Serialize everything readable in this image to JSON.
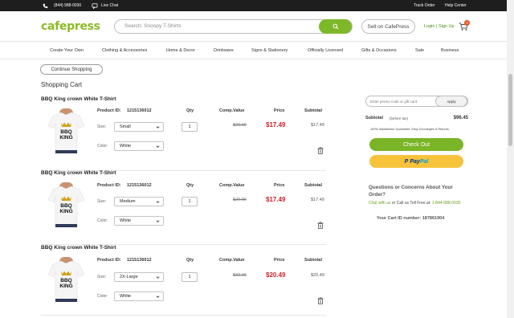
{
  "topbar": {
    "phone": "(844) 988-0030",
    "live_chat": "Live Chat",
    "track_order": "Track Order",
    "help_center": "Help Center"
  },
  "header": {
    "logo": "cafepress",
    "search_placeholder": "Search: Snoopy T-Shirts",
    "sell": "Sell on CafePress",
    "login": "Login | Sign Up",
    "cart_count": "3"
  },
  "nav": [
    "Create Your Own",
    "Clothing & Accessories",
    "Home & Decor",
    "Drinkware",
    "Signs & Stationery",
    "Officially Licensed",
    "Gifts & Occasions",
    "Sale",
    "Business"
  ],
  "page": {
    "continue_shopping": "Continue Shopping",
    "heading": "Shopping Cart"
  },
  "columns": {
    "product_id": "Product ID:",
    "qty": "Qty",
    "comp_value": "Comp.Value",
    "price": "Price",
    "subtotal": "Subtotal",
    "size": "Size:",
    "color": "Color:"
  },
  "items": [
    {
      "title": "BBQ King crown White T-Shirt",
      "product_id": "1215136012",
      "size": "Small",
      "color": "White",
      "qty": "1",
      "comp_value": "$29.99",
      "price": "$17.49",
      "subtotal": "$17.49",
      "shirt_text": "BBQ KING"
    },
    {
      "title": "BBQ King crown White T-Shirt",
      "product_id": "1215136012",
      "size": "Medium",
      "color": "White",
      "qty": "1",
      "comp_value": "$29.99",
      "price": "$17.49",
      "subtotal": "$17.49",
      "shirt_text": "BBQ KING"
    },
    {
      "title": "BBQ King crown White T-Shirt",
      "product_id": "1215136012",
      "size": "2X-Large",
      "color": "White",
      "qty": "1",
      "comp_value": "$32.99",
      "price": "$20.49",
      "subtotal": "$20.49",
      "shirt_text": "BBQ KING"
    }
  ],
  "sidebar": {
    "promo_placeholder": "Enter promo code or gift card",
    "apply": "Apply",
    "subtotal_label": "Subtotal",
    "before_tax": "(before tax)",
    "subtotal_value": "$96.45",
    "guarantee": "100% Satisfaction Guarantee. Easy Exchanges & Returns.",
    "checkout": "Check Out",
    "paypal_pay": "Pay",
    "paypal_pal": "Pal",
    "questions": "Questions or Concerns About Your Order?",
    "chat_link": "Chat with us",
    "call_text": " or Call us Toll Free at: ",
    "phone": "1-844-988-0030",
    "cart_id": "Your Cart ID number: 187861904"
  },
  "colors": {
    "brand_green": "#8bbb27",
    "price_red": "#d2222a",
    "paypal_yellow": "#f7c33b"
  }
}
